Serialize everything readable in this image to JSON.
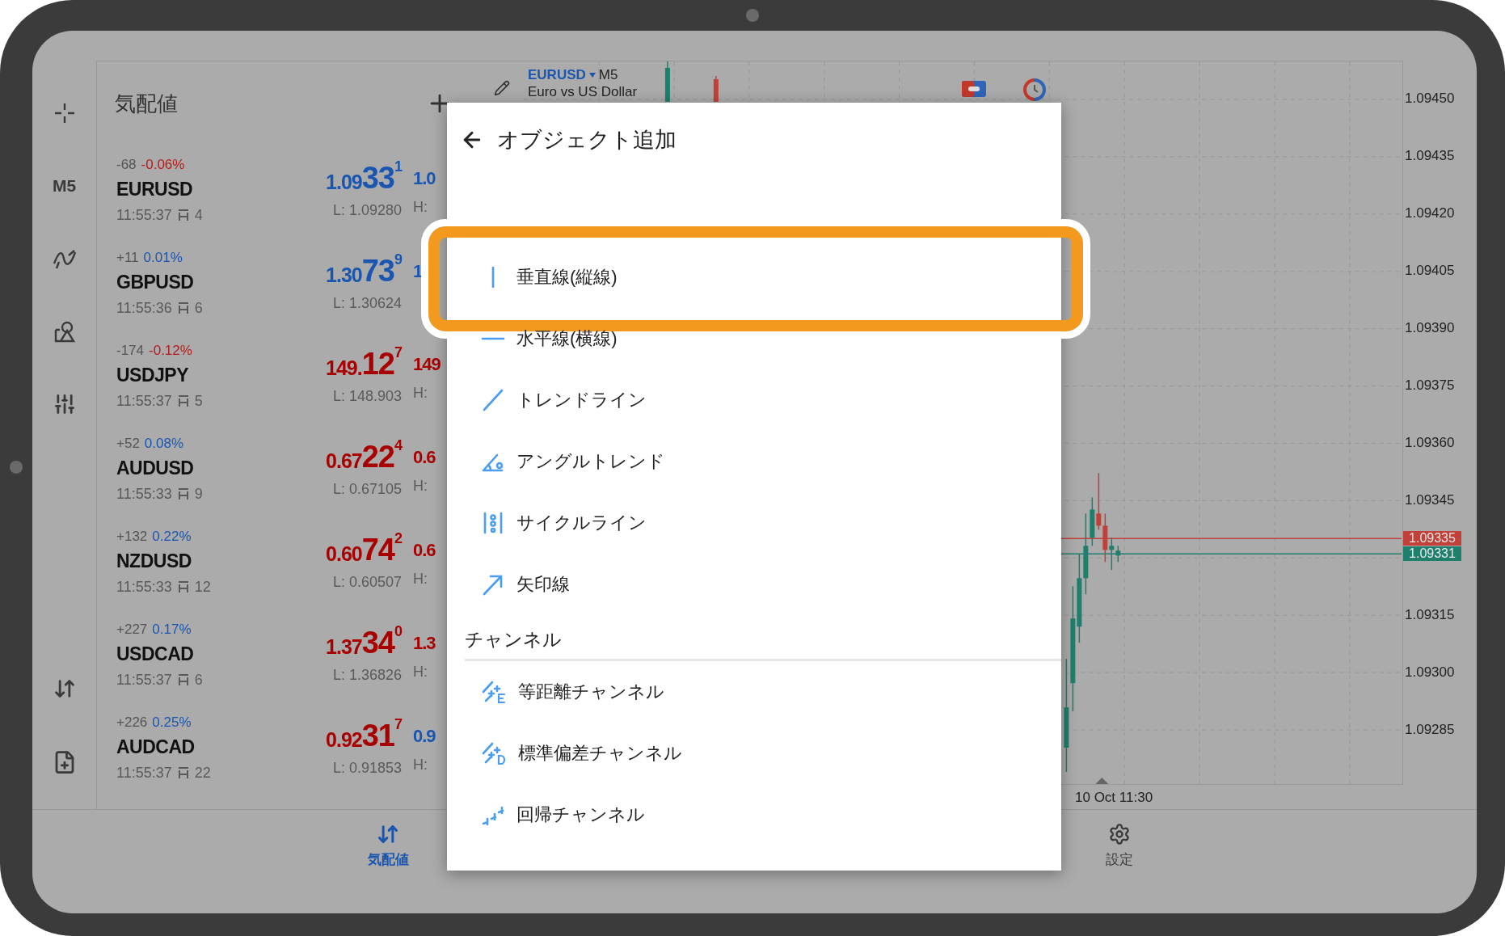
{
  "rail": {
    "timeframe": "M5"
  },
  "watchlist": {
    "title": "気配値",
    "quotes": [
      {
        "change": "-68",
        "change_pct": {
          "text": "-0.06%",
          "color": "#b71c1c"
        },
        "symbol": "EURUSD",
        "time": "11:55:37",
        "spread": "4",
        "bid": {
          "head": "1.09",
          "big": "33",
          "sup": "1",
          "color": "#1a56b0"
        },
        "low": "L: 1.09280",
        "ask": {
          "text": "1.0",
          "color": "#1a56b0"
        },
        "high": "H:"
      },
      {
        "change": "+11",
        "change_pct": {
          "text": "0.01%",
          "color": "#1a56b0"
        },
        "symbol": "GBPUSD",
        "time": "11:55:36",
        "spread": "6",
        "bid": {
          "head": "1.30",
          "big": "73",
          "sup": "9",
          "color": "#1a56b0"
        },
        "low": "L: 1.30624",
        "ask": {
          "text": "1",
          "color": "#1a56b0"
        }
      },
      {
        "change": "-174",
        "change_pct": {
          "text": "-0.12%",
          "color": "#b71c1c"
        },
        "symbol": "USDJPY",
        "time": "11:55:37",
        "spread": "5",
        "bid": {
          "head": "149.",
          "big": "12",
          "sup": "7",
          "color": "#a80000"
        },
        "low": "L: 148.903",
        "ask": {
          "text": "149",
          "color": "#a80000"
        },
        "high": "H:"
      },
      {
        "change": "+52",
        "change_pct": {
          "text": "0.08%",
          "color": "#1a56b0"
        },
        "symbol": "AUDUSD",
        "time": "11:55:33",
        "spread": "9",
        "bid": {
          "head": "0.67",
          "big": "22",
          "sup": "4",
          "color": "#a80000"
        },
        "low": "L: 0.67105",
        "ask": {
          "text": "0.6",
          "color": "#a80000"
        },
        "high": "H:"
      },
      {
        "change": "+132",
        "change_pct": {
          "text": "0.22%",
          "color": "#1a56b0"
        },
        "symbol": "NZDUSD",
        "time": "11:55:33",
        "spread": "12",
        "bid": {
          "head": "0.60",
          "big": "74",
          "sup": "2",
          "color": "#a80000"
        },
        "low": "L: 0.60507",
        "ask": {
          "text": "0.6",
          "color": "#a80000"
        },
        "high": "H:"
      },
      {
        "change": "+227",
        "change_pct": {
          "text": "0.17%",
          "color": "#1a56b0"
        },
        "symbol": "USDCAD",
        "time": "11:55:37",
        "spread": "6",
        "bid": {
          "head": "1.37",
          "big": "34",
          "sup": "0",
          "color": "#a80000"
        },
        "low": "L: 1.36826",
        "ask": {
          "text": "1.3",
          "color": "#a80000"
        },
        "high": "H:"
      },
      {
        "change": "+226",
        "change_pct": {
          "text": "0.25%",
          "color": "#1a56b0"
        },
        "symbol": "AUDCAD",
        "time": "11:55:37",
        "spread": "22",
        "bid": {
          "head": "0.92",
          "big": "31",
          "sup": "7",
          "color": "#a80000"
        },
        "low": "L: 0.91853",
        "ask": {
          "text": "0.9",
          "color": "#1a56b0"
        },
        "high": "H:"
      }
    ]
  },
  "chart": {
    "symbol": "EURUSD",
    "timeframe": "M5",
    "description": "Euro vs US Dollar",
    "price_axis": [
      "1.09450",
      "1.09435",
      "1.09420",
      "1.09405",
      "1.09390",
      "1.09375",
      "1.09360",
      "1.09345",
      "1.09315",
      "1.09300",
      "1.09285"
    ],
    "bid_label": {
      "text": "1.09335",
      "color": "#c2403a"
    },
    "ask_label": {
      "text": "1.09331",
      "color": "#1f7f6d"
    },
    "time_label": "10 Oct 11:30"
  },
  "dialog": {
    "title": "オブジェクト追加",
    "sections": [
      {
        "items": [
          {
            "label": "垂直線(縦線)",
            "kind": "vline",
            "highlighted": true
          },
          {
            "label": "水平線(横線)",
            "kind": "hline",
            "highlighted": false
          },
          {
            "label": "トレンドライン",
            "kind": "trend",
            "highlighted": false
          },
          {
            "label": "アングルトレンド",
            "kind": "angle",
            "highlighted": false
          },
          {
            "label": "サイクルライン",
            "kind": "cycle",
            "highlighted": false
          },
          {
            "label": "矢印線",
            "kind": "arrow",
            "highlighted": false
          }
        ]
      },
      {
        "title": "チャンネル",
        "items": [
          {
            "label": "等距離チャンネル",
            "kind": "equidistant",
            "highlighted": false
          },
          {
            "label": "標準偏差チャンネル",
            "kind": "stddev",
            "highlighted": false
          },
          {
            "label": "回帰チャンネル",
            "kind": "regression",
            "highlighted": false
          }
        ]
      }
    ]
  },
  "nav": [
    {
      "label": "気配値",
      "selected": true
    },
    {
      "label": "設定",
      "selected": false
    }
  ]
}
